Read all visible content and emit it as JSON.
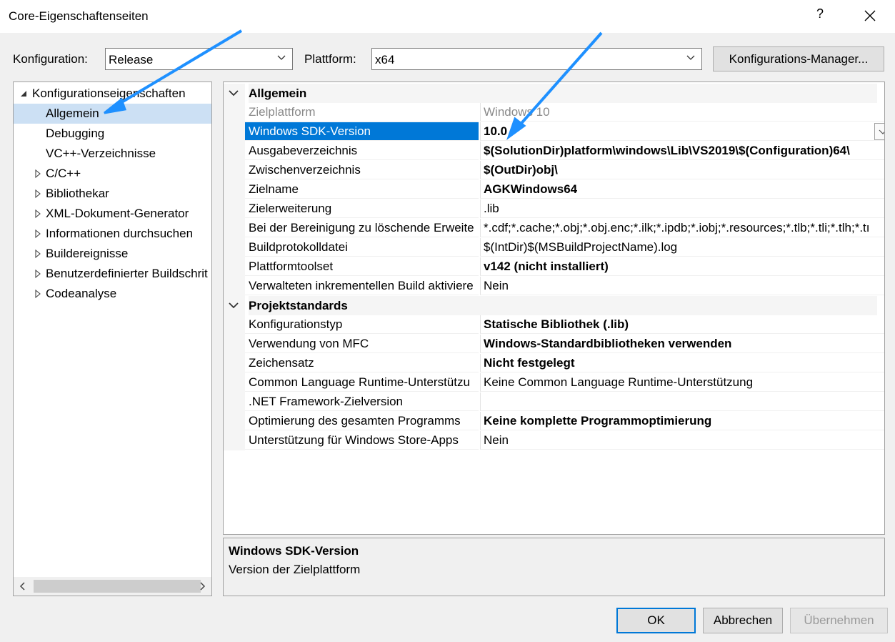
{
  "window": {
    "title": "Core-Eigenschaftenseiten",
    "help_icon": "question-mark",
    "close_icon": "close-x"
  },
  "toolbar": {
    "config_label": "Konfiguration:",
    "config_value": "Release",
    "platform_label": "Plattform:",
    "platform_value": "x64",
    "config_manager_button": "Konfigurations-Manager..."
  },
  "tree": {
    "root": "Konfigurationseigenschaften",
    "items": [
      {
        "label": "Allgemein",
        "selected": true,
        "expandable": false
      },
      {
        "label": "Debugging",
        "expandable": false
      },
      {
        "label": "VC++-Verzeichnisse",
        "expandable": false
      },
      {
        "label": "C/C++",
        "expandable": true
      },
      {
        "label": "Bibliothekar",
        "expandable": true
      },
      {
        "label": "XML-Dokument-Generator",
        "expandable": true
      },
      {
        "label": "Informationen durchsuchen",
        "expandable": true
      },
      {
        "label": "Buildereignisse",
        "expandable": true
      },
      {
        "label": "Benutzerdefinierter Buildschrit",
        "expandable": true
      },
      {
        "label": "Codeanalyse",
        "expandable": true
      }
    ]
  },
  "properties": {
    "sections": [
      {
        "title": "Allgemein",
        "rows": [
          {
            "name": "Zielplattform",
            "value": "Windows 10",
            "dim": true
          },
          {
            "name": "Windows SDK-Version",
            "value": "10.0",
            "bold": true,
            "selected": true
          },
          {
            "name": "Ausgabeverzeichnis",
            "value": "$(SolutionDir)platform\\windows\\Lib\\VS2019\\$(Configuration)64\\",
            "bold": true
          },
          {
            "name": "Zwischenverzeichnis",
            "value": "$(OutDir)obj\\",
            "bold": true
          },
          {
            "name": "Zielname",
            "value": "AGKWindows64",
            "bold": true
          },
          {
            "name": "Zielerweiterung",
            "value": ".lib"
          },
          {
            "name": "Bei der Bereinigung zu löschende Erweite",
            "value": "*.cdf;*.cache;*.obj;*.obj.enc;*.ilk;*.ipdb;*.iobj;*.resources;*.tlb;*.tli;*.tlh;*.tı"
          },
          {
            "name": "Buildprotokolldatei",
            "value": "$(IntDir)$(MSBuildProjectName).log"
          },
          {
            "name": "Plattformtoolset",
            "value": "v142 (nicht installiert)",
            "bold": true
          },
          {
            "name": "Verwalteten inkrementellen Build aktiviere",
            "value": "Nein"
          }
        ]
      },
      {
        "title": "Projektstandards",
        "rows": [
          {
            "name": "Konfigurationstyp",
            "value": "Statische Bibliothek (.lib)",
            "bold": true
          },
          {
            "name": "Verwendung von MFC",
            "value": "Windows-Standardbibliotheken verwenden",
            "bold": true
          },
          {
            "name": "Zeichensatz",
            "value": "Nicht festgelegt",
            "bold": true
          },
          {
            "name": "Common Language Runtime-Unterstützu",
            "value": "Keine Common Language Runtime-Unterstützung"
          },
          {
            "name": ".NET Framework-Zielversion",
            "value": ""
          },
          {
            "name": "Optimierung des gesamten Programms",
            "value": "Keine komplette Programmoptimierung",
            "bold": true
          },
          {
            "name": "Unterstützung für Windows Store-Apps",
            "value": "Nein"
          }
        ]
      }
    ]
  },
  "description": {
    "title": "Windows SDK-Version",
    "text": "Version der Zielplattform"
  },
  "buttons": {
    "ok": "OK",
    "cancel": "Abbrechen",
    "apply": "Übernehmen"
  },
  "colors": {
    "selection_blue": "#0078d7",
    "tree_selection": "#cce0f4",
    "annotation_arrow": "#1e90ff"
  }
}
